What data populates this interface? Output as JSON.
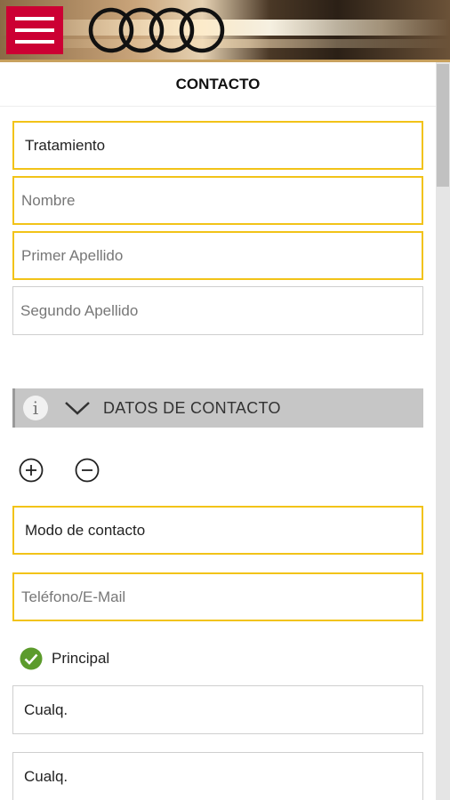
{
  "header": {
    "menu_icon": "hamburger-menu-icon",
    "logo": "audi-rings-logo",
    "accent_color": "#cc0033"
  },
  "page": {
    "title": "CONTACTO"
  },
  "form": {
    "tratamiento": "Tratamiento",
    "nombre_placeholder": "Nombre",
    "primer_apellido_placeholder": "Primer Apellido",
    "segundo_apellido_placeholder": "Segundo Apellido"
  },
  "section": {
    "title": "DATOS DE CONTACTO",
    "info_icon": "info-icon",
    "collapse_icon": "chevron-down-icon"
  },
  "contact": {
    "add_icon": "plus-circle-icon",
    "remove_icon": "minus-circle-icon",
    "modo_contacto": "Modo de contacto",
    "telefono_placeholder": "Teléfono/E-Mail",
    "principal_label": "Principal",
    "cualq_1": "Cualq.",
    "cualq_2": "Cualq."
  },
  "colors": {
    "required_border": "#f2c318",
    "section_bg": "#c6c6c6",
    "check_green": "#5c9b2c"
  }
}
